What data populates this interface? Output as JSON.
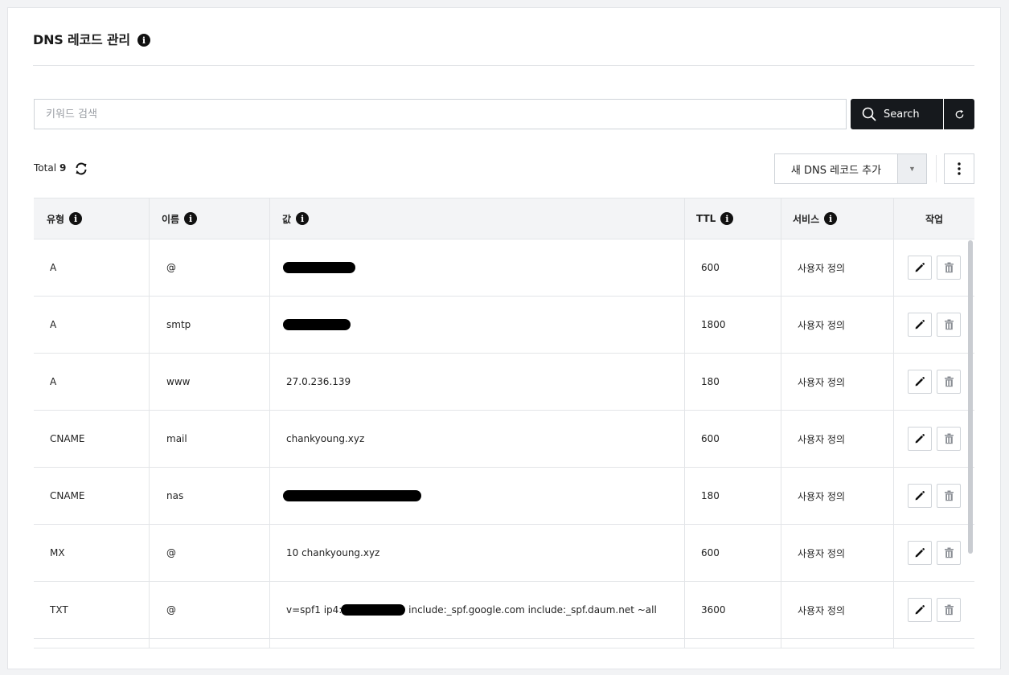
{
  "header": {
    "title": "DNS 레코드 관리"
  },
  "search": {
    "placeholder": "키워드 검색",
    "button_label": "Search"
  },
  "toolbar": {
    "total_label": "Total",
    "total_count": "9",
    "add_label": "새 DNS 레코드 추가",
    "dropdown_caret": "▼"
  },
  "table": {
    "columns": [
      "유형",
      "이름",
      "값",
      "TTL",
      "서비스",
      "작업"
    ],
    "rows": [
      {
        "type": "A",
        "name": "@",
        "value": "",
        "value_redacted": true,
        "ttl": "600",
        "service": "사용자 정의"
      },
      {
        "type": "A",
        "name": "smtp",
        "value": "",
        "value_redacted": true,
        "ttl": "1800",
        "service": "사용자 정의"
      },
      {
        "type": "A",
        "name": "www",
        "value": "27.0.236.139",
        "value_redacted": false,
        "ttl": "180",
        "service": "사용자 정의"
      },
      {
        "type": "CNAME",
        "name": "mail",
        "value": "chankyoung.xyz",
        "value_redacted": false,
        "ttl": "600",
        "service": "사용자 정의"
      },
      {
        "type": "CNAME",
        "name": "nas",
        "value": "",
        "value_redacted": true,
        "ttl": "180",
        "service": "사용자 정의"
      },
      {
        "type": "MX",
        "name": "@",
        "value": "10 chankyoung.xyz",
        "value_redacted": false,
        "ttl": "600",
        "service": "사용자 정의"
      },
      {
        "type": "TXT",
        "name": "@",
        "value_prefix": "v=spf1 ip4:",
        "value_suffix": " include:_spf.google.com include:_spf.daum.net ~all",
        "value_redacted": "partial",
        "ttl": "3600",
        "service": "사용자 정의"
      }
    ]
  },
  "icons": {
    "info": "info-icon",
    "search": "search-icon",
    "reset": "reset-icon",
    "refresh": "refresh-icon",
    "more": "more-vertical-icon",
    "edit": "pencil-icon",
    "delete": "trash-icon"
  },
  "colors": {
    "primary_button": "#16191d",
    "header_bg": "#f3f4f6",
    "border": "#e3e5e8"
  }
}
